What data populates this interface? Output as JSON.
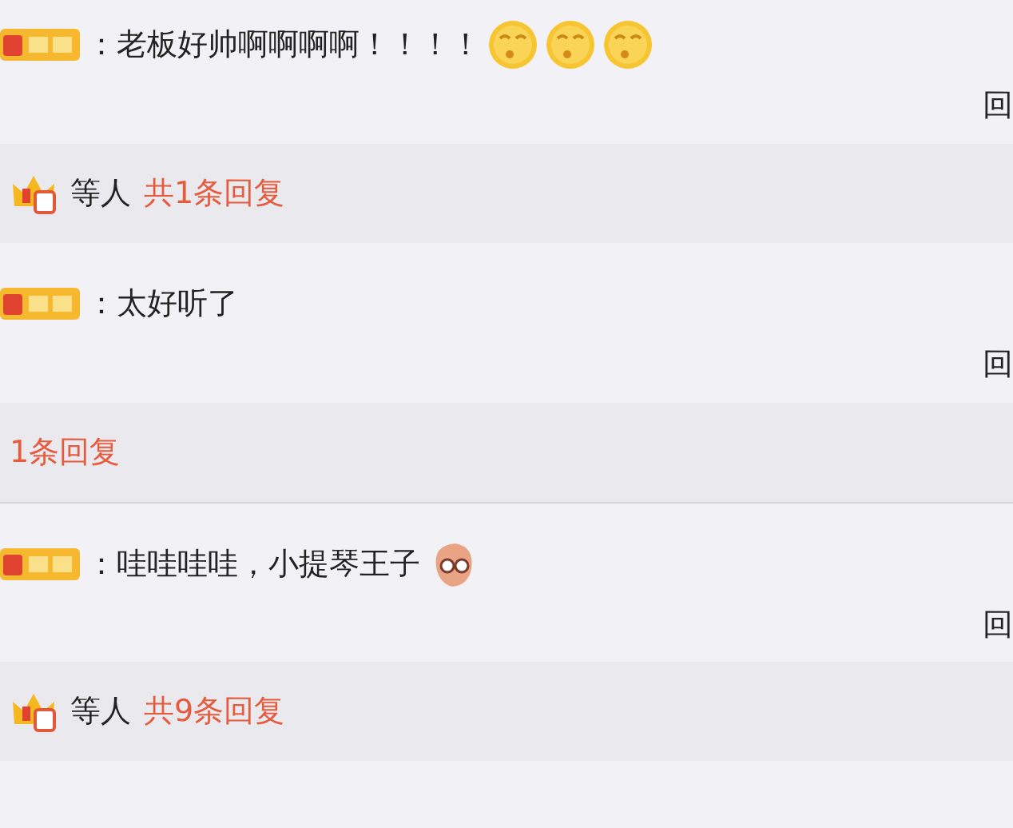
{
  "feed": [
    {
      "kind": "comment",
      "badge": {
        "kind": "vip"
      },
      "text": "：老板好帅啊啊啊啊！！！！",
      "emojis": [
        {
          "kind": "smiley"
        },
        {
          "kind": "smiley"
        },
        {
          "kind": "smiley"
        }
      ],
      "action": "回"
    },
    {
      "kind": "reply_bar",
      "crown": true,
      "users_label": "等人",
      "link": "共1条回复"
    },
    {
      "kind": "comment",
      "badge": {
        "kind": "vip"
      },
      "text": "：太好听了",
      "action": "回"
    },
    {
      "kind": "reply_bar",
      "crown": false,
      "link": "1条回复"
    },
    {
      "kind": "comment",
      "badge": {
        "kind": "vip"
      },
      "divider_above": true,
      "text": "：哇哇哇哇，小提琴王子",
      "emojis": [
        {
          "kind": "blob"
        }
      ],
      "action": "回"
    },
    {
      "kind": "reply_bar",
      "crown": true,
      "users_label": "等人",
      "link": "共9条回复"
    }
  ]
}
